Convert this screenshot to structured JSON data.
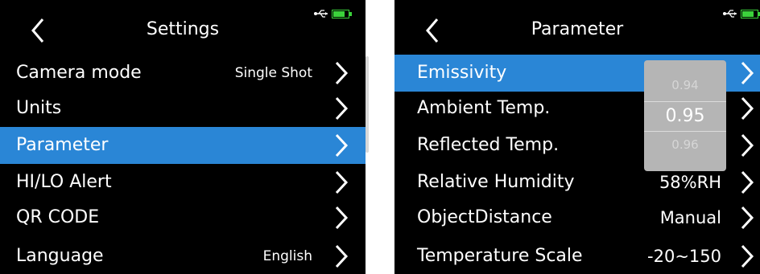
{
  "settings": {
    "title": "Settings",
    "items": [
      {
        "label": "Camera mode",
        "value": "Single Shot"
      },
      {
        "label": "Units",
        "value": ""
      },
      {
        "label": "Parameter",
        "value": ""
      },
      {
        "label": "HI/LO Alert",
        "value": ""
      },
      {
        "label": "QR CODE",
        "value": ""
      },
      {
        "label": "Language",
        "value": "English"
      }
    ],
    "selected": "Parameter"
  },
  "parameter": {
    "title": "Parameter",
    "items": [
      {
        "label": "Emissivity",
        "value": ""
      },
      {
        "label": "Ambient Temp.",
        "value": ""
      },
      {
        "label": "Reflected Temp.",
        "value": ""
      },
      {
        "label": "Relative Humidity",
        "value": "58%RH"
      },
      {
        "label": "ObjectDistance",
        "value": "Manual"
      },
      {
        "label": "Temperature Scale",
        "value": "-20~150"
      }
    ],
    "selected": "Emissivity",
    "emissivity_picker": {
      "prev": "0.94",
      "current": "0.95",
      "next": "0.96"
    }
  },
  "colors": {
    "selection": "#2a86d6",
    "battery": "#3bd23b",
    "background": "#000000"
  },
  "icons": {
    "back": "chevron-left-icon",
    "forward": "chevron-right-icon",
    "usb": "usb-icon",
    "battery": "battery-charging-icon"
  }
}
